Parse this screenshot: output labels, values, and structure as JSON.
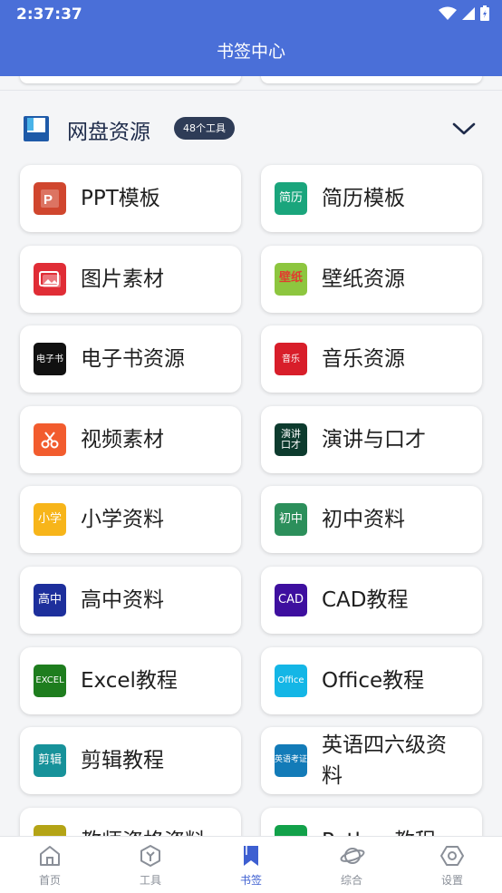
{
  "status_bar": {
    "time": "2:37:37"
  },
  "header": {
    "title": "书签中心"
  },
  "section": {
    "title": "网盘资源",
    "badge": "48个工具"
  },
  "tools": [
    {
      "label": "PPT模板",
      "icon_text": "",
      "icon": "ppt-icon",
      "color": "#d0462e"
    },
    {
      "label": "简历模板",
      "icon_text": "简历",
      "icon": "resume-icon",
      "color": "#1aa57c"
    },
    {
      "label": "图片素材",
      "icon_text": "",
      "icon": "image-icon",
      "color": "#e02d36"
    },
    {
      "label": "壁纸资源",
      "icon_text": "壁纸",
      "icon": "wallpaper-icon",
      "color": "#8dc63f"
    },
    {
      "label": "电子书资源",
      "icon_text": "电子书",
      "icon": "ebook-icon",
      "color": "#111111"
    },
    {
      "label": "音乐资源",
      "icon_text": "音乐",
      "icon": "music-icon",
      "color": "#d81e2a"
    },
    {
      "label": "视频素材",
      "icon_text": "",
      "icon": "scissors-icon",
      "color": "#f25c2e"
    },
    {
      "label": "演讲与口才",
      "icon_text": "演讲口才",
      "icon": "speech-icon",
      "color": "#0d3b2e"
    },
    {
      "label": "小学资料",
      "icon_text": "小学",
      "icon": "primary-school-icon",
      "color": "#f7b51a"
    },
    {
      "label": "初中资料",
      "icon_text": "初中",
      "icon": "middle-school-icon",
      "color": "#2c8f5b"
    },
    {
      "label": "高中资料",
      "icon_text": "高中",
      "icon": "high-school-icon",
      "color": "#1d2f9c"
    },
    {
      "label": "CAD教程",
      "icon_text": "CAD",
      "icon": "cad-icon",
      "color": "#3e0f9f"
    },
    {
      "label": "Excel教程",
      "icon_text": "EXCEL",
      "icon": "excel-icon",
      "color": "#1e7d1e"
    },
    {
      "label": "Office教程",
      "icon_text": "Office",
      "icon": "office-icon",
      "color": "#14b6e6"
    },
    {
      "label": "剪辑教程",
      "icon_text": "剪辑",
      "icon": "editing-icon",
      "color": "#17929a"
    },
    {
      "label": "英语四六级资料",
      "icon_text": "英语考证",
      "icon": "english-icon",
      "color": "#137bb8"
    },
    {
      "label": "教师资格资料",
      "icon_text": "",
      "icon": "teacher-icon",
      "color": "#b4a416"
    },
    {
      "label": "Python教程",
      "icon_text": "",
      "icon": "python-icon",
      "color": "#12a14a"
    }
  ],
  "bottom_nav": [
    {
      "label": "首页",
      "icon": "home-icon"
    },
    {
      "label": "工具",
      "icon": "tools-icon"
    },
    {
      "label": "书签",
      "icon": "bookmark-icon",
      "active": true
    },
    {
      "label": "综合",
      "icon": "planet-icon"
    },
    {
      "label": "设置",
      "icon": "settings-icon"
    }
  ]
}
